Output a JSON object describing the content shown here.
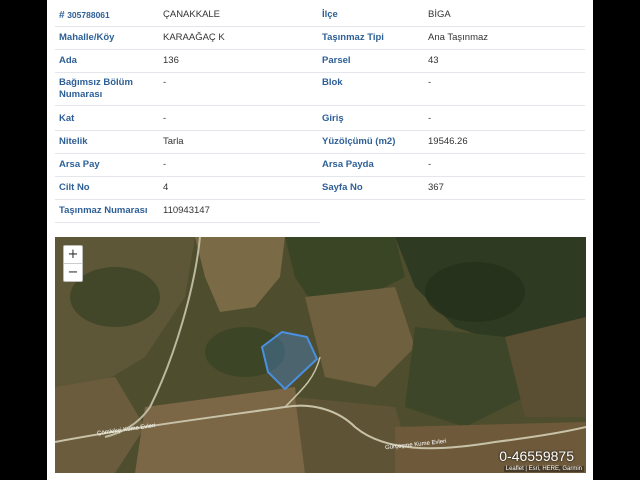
{
  "record_id": "305788061",
  "il": "ÇANAKKALE",
  "fields_left": [
    {
      "label": "Mahalle/Köy",
      "value": "KARAAĞAÇ K"
    },
    {
      "label": "Ada",
      "value": "136"
    },
    {
      "label": "Bağımsız Bölüm Numarası",
      "value": "-"
    },
    {
      "label": "Kat",
      "value": "-"
    },
    {
      "label": "Nitelik",
      "value": "Tarla"
    },
    {
      "label": "Arsa Pay",
      "value": "-"
    },
    {
      "label": "Cilt No",
      "value": "4"
    },
    {
      "label": "Taşınmaz Numarası",
      "value": "110943147"
    }
  ],
  "fields_right": [
    {
      "label": "İlçe",
      "value": "BİGA"
    },
    {
      "label": "Taşınmaz Tipi",
      "value": "Ana Taşınmaz"
    },
    {
      "label": "Parsel",
      "value": "43"
    },
    {
      "label": "Blok",
      "value": "-"
    },
    {
      "label": "Giriş",
      "value": "-"
    },
    {
      "label": "Yüzölçümü (m2)",
      "value": "19546.26"
    },
    {
      "label": "Arsa Payda",
      "value": "-"
    },
    {
      "label": "Sayfa No",
      "value": "367"
    }
  ],
  "map": {
    "zoom_in": "+",
    "zoom_out": "−",
    "road_label_1": "Çömlekçi Kume Evleri",
    "road_label_2": "Gürçeşme Kume Evleri",
    "attribution": "Leaflet | Esri, HERE, Garmin",
    "listing_number": "0-46559875",
    "zoom_in_icon": "plus-icon",
    "zoom_out_icon": "minus-icon"
  },
  "colors": {
    "label": "#2d5f96",
    "parcel": "#4a90e2"
  }
}
